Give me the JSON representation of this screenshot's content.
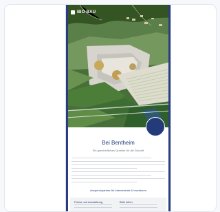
{
  "preview": {
    "logo_text": "IBO BAU",
    "hero_alt": "aerial-view-landscape",
    "badge_text": "",
    "headline": "Bei Bentheim",
    "subline": "Ein ganzheitliches Quartier für die Zukunft",
    "section_title": "Ansprechpartner für Interessierte & Investoren",
    "bottom": {
      "left_title": "Preise und Ausstattung",
      "right_title": "Bitte teilen"
    }
  },
  "icons": {
    "logo_mark": "logo-mark-icon"
  },
  "colors": {
    "brand_blue": "#243b7a",
    "rail_blue": "#2a3e7f",
    "card_bg": "#ffffff",
    "page_bg": "#f7f8fb"
  }
}
